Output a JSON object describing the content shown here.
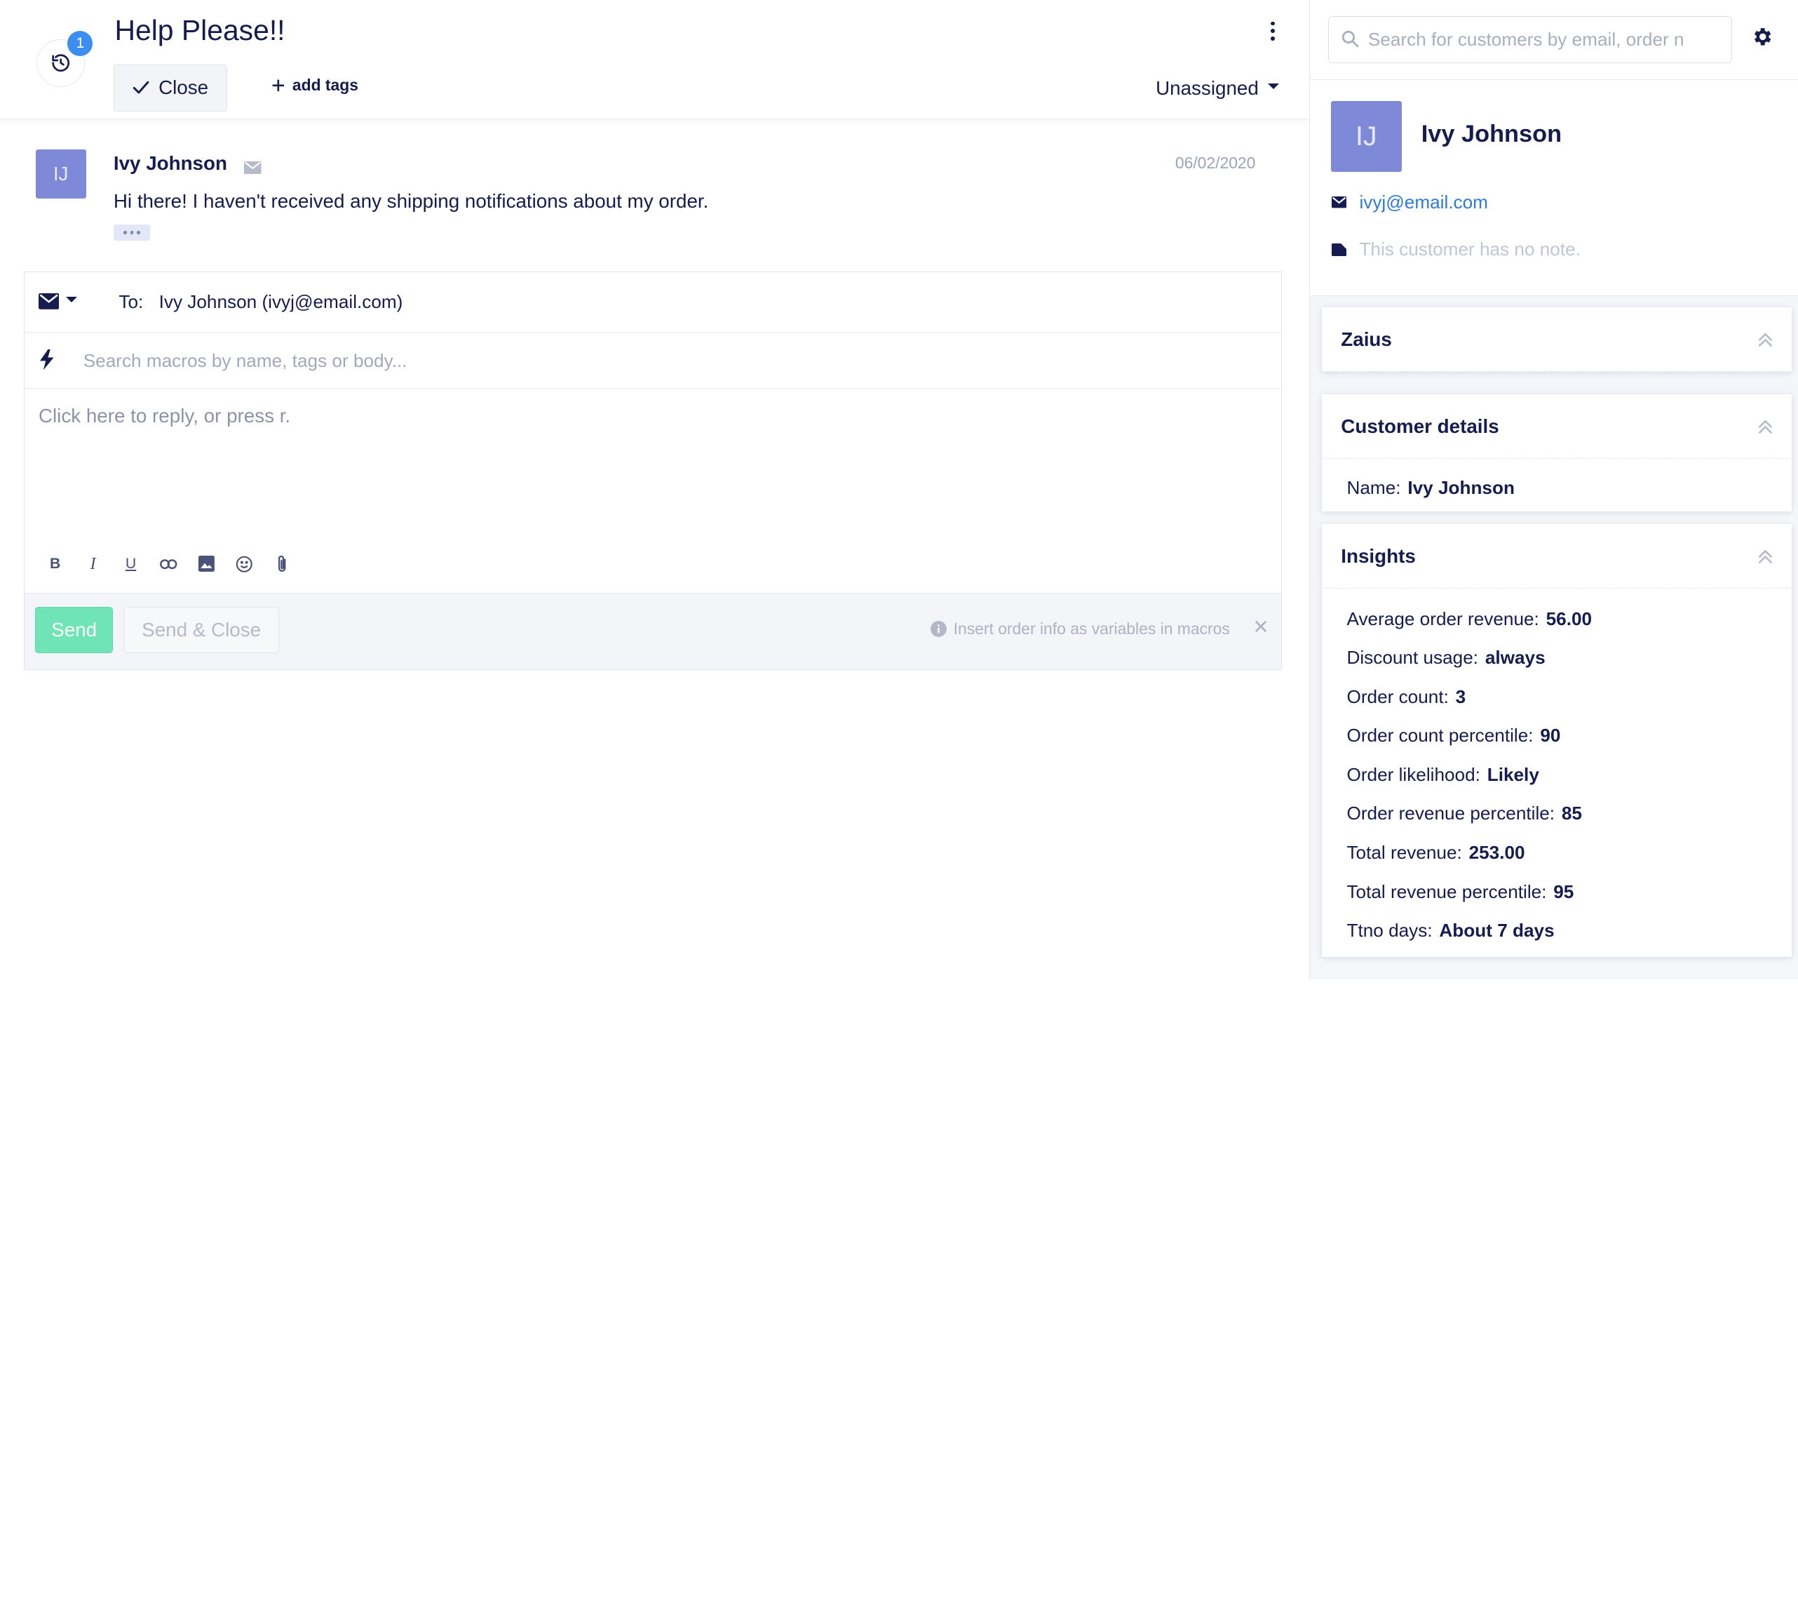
{
  "ticket": {
    "title": "Help Please!!",
    "history_count": "1",
    "close_label": "Close",
    "add_tags_label": "add tags",
    "assignee": "Unassigned"
  },
  "message": {
    "avatar_initials": "IJ",
    "author": "Ivy Johnson",
    "date": "06/02/2020",
    "body": "Hi there! I haven't received any shipping notifications about my order."
  },
  "composer": {
    "to_label": "To:",
    "to_value": "Ivy Johnson (ivyj@email.com)",
    "macro_placeholder": "Search macros by name, tags or body...",
    "reply_placeholder": "Click here to reply, or press r.",
    "send_label": "Send",
    "send_close_label": "Send & Close",
    "hint": "Insert order info as variables in macros",
    "toolbar": [
      "bold-icon",
      "italic-icon",
      "underline-icon",
      "link-icon",
      "image-icon",
      "emoji-icon",
      "attachment-icon"
    ]
  },
  "sidebar": {
    "search_placeholder": "Search for customers by email, order n",
    "customer": {
      "avatar_initials": "IJ",
      "name": "Ivy Johnson",
      "email": "ivyj@email.com",
      "note": "This customer has no note."
    },
    "widgets": {
      "zaius": {
        "title": "Zaius"
      },
      "details": {
        "title": "Customer details",
        "rows": [
          {
            "label": "Name:",
            "value": "Ivy Johnson"
          }
        ]
      },
      "insights": {
        "title": "Insights",
        "rows": [
          {
            "label": "Average order revenue:",
            "value": "56.00"
          },
          {
            "label": "Discount usage:",
            "value": "always"
          },
          {
            "label": "Order count:",
            "value": "3"
          },
          {
            "label": "Order count percentile:",
            "value": "90"
          },
          {
            "label": "Order likelihood:",
            "value": "Likely"
          },
          {
            "label": "Order revenue percentile:",
            "value": "85"
          },
          {
            "label": "Total revenue:",
            "value": "253.00"
          },
          {
            "label": "Total revenue percentile:",
            "value": "95"
          },
          {
            "label": "Ttno days:",
            "value": "About 7 days"
          }
        ]
      }
    }
  },
  "colors": {
    "text": "#161c4f",
    "accent_blue": "#3b8df0",
    "avatar": "#7e8ad8",
    "send_green": "#6fe4b6",
    "link": "#2d7ad8"
  }
}
